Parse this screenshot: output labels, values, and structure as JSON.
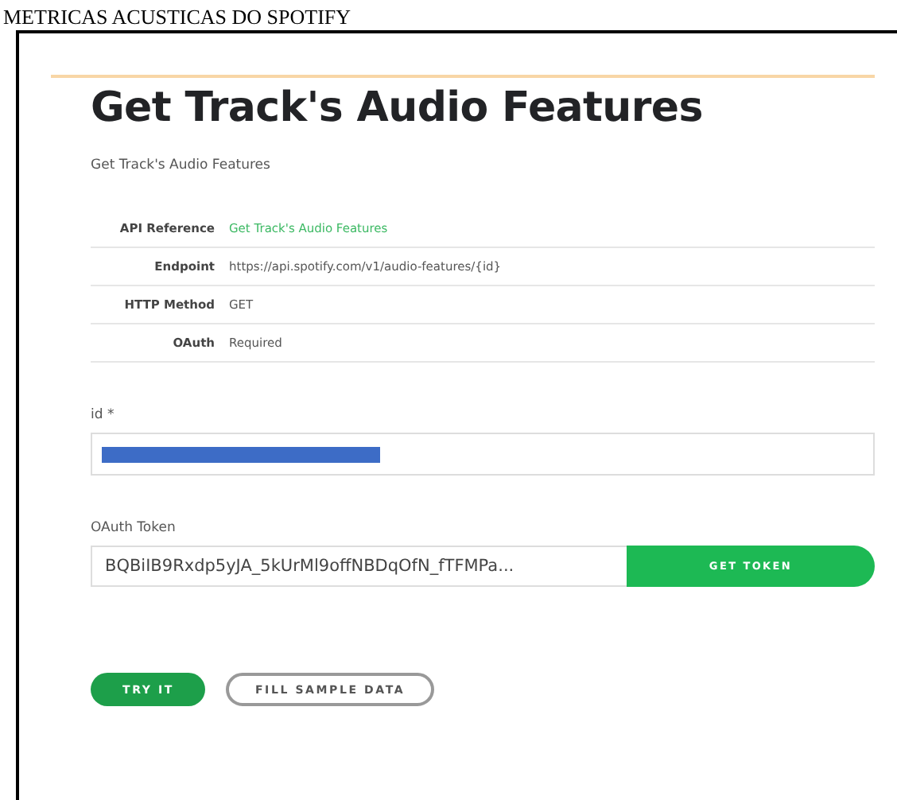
{
  "caption": "METRICAS ACUSTICAS DO SPOTIFY",
  "title": "Get Track's Audio Features",
  "subtitle": "Get Track's Audio Features",
  "info_rows": [
    {
      "label": "API Reference",
      "value": "Get Track's Audio Features",
      "kind": "link"
    },
    {
      "label": "Endpoint",
      "value": "https://api.spotify.com/v1/audio-features/{id}",
      "kind": "text"
    },
    {
      "label": "HTTP Method",
      "value": "GET",
      "kind": "text"
    },
    {
      "label": "OAuth",
      "value": "Required",
      "kind": "text"
    }
  ],
  "id_field": {
    "label": "id *",
    "redacted": true
  },
  "token_field": {
    "label": "OAuth Token",
    "value": "BQBiIB9Rxdp5yJA_5kUrMl9offNBDqOfN_fTFMPa...",
    "button": "GET TOKEN"
  },
  "buttons": [
    {
      "label": "TRY IT",
      "kind": "primary"
    },
    {
      "label": "FILL SAMPLE DATA",
      "kind": "outline"
    }
  ]
}
